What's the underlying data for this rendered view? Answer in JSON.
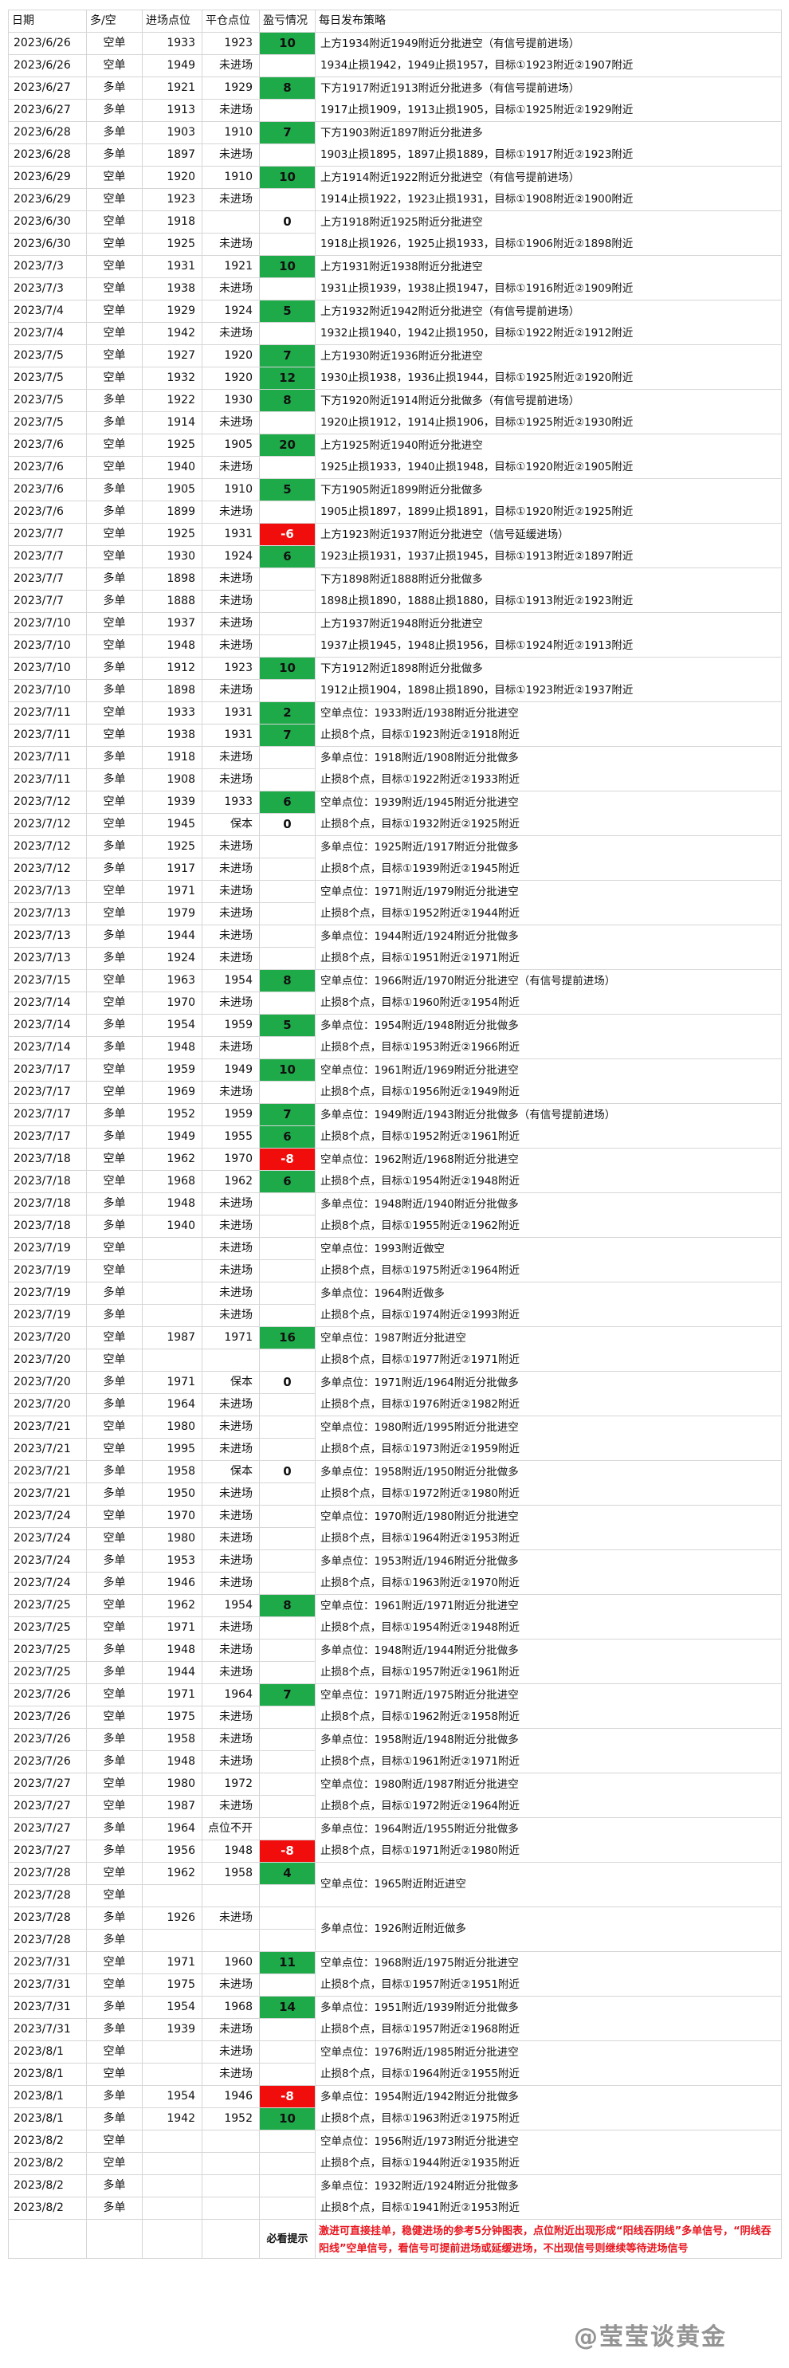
{
  "headers": [
    "日期",
    "多/空",
    "进场点位",
    "平仓点位",
    "盈亏情况",
    "每日发布策略"
  ],
  "rows": [
    {
      "d": "2023/6/26",
      "s": "空单",
      "e": "1933",
      "c": "1923",
      "p": "10"
    },
    {
      "d": "2023/6/26",
      "s": "空单",
      "e": "1949",
      "c": "未进场",
      "p": ""
    },
    {
      "d": "2023/6/27",
      "s": "多单",
      "e": "1921",
      "c": "1929",
      "p": "8"
    },
    {
      "d": "2023/6/27",
      "s": "多单",
      "e": "1913",
      "c": "未进场",
      "p": ""
    },
    {
      "d": "2023/6/28",
      "s": "多单",
      "e": "1903",
      "c": "1910",
      "p": "7"
    },
    {
      "d": "2023/6/28",
      "s": "多单",
      "e": "1897",
      "c": "未进场",
      "p": ""
    },
    {
      "d": "2023/6/29",
      "s": "空单",
      "e": "1920",
      "c": "1910",
      "p": "10"
    },
    {
      "d": "2023/6/29",
      "s": "空单",
      "e": "1923",
      "c": "未进场",
      "p": ""
    },
    {
      "d": "2023/6/30",
      "s": "空单",
      "e": "1918",
      "c": "",
      "p": "0"
    },
    {
      "d": "2023/6/30",
      "s": "空单",
      "e": "1925",
      "c": "未进场",
      "p": ""
    },
    {
      "d": "2023/7/3",
      "s": "空单",
      "e": "1931",
      "c": "1921",
      "p": "10"
    },
    {
      "d": "2023/7/3",
      "s": "空单",
      "e": "1938",
      "c": "未进场",
      "p": ""
    },
    {
      "d": "2023/7/4",
      "s": "空单",
      "e": "1929",
      "c": "1924",
      "p": "5"
    },
    {
      "d": "2023/7/4",
      "s": "空单",
      "e": "1942",
      "c": "未进场",
      "p": ""
    },
    {
      "d": "2023/7/5",
      "s": "空单",
      "e": "1927",
      "c": "1920",
      "p": "7"
    },
    {
      "d": "2023/7/5",
      "s": "空单",
      "e": "1932",
      "c": "1920",
      "p": "12"
    },
    {
      "d": "2023/7/5",
      "s": "多单",
      "e": "1922",
      "c": "1930",
      "p": "8"
    },
    {
      "d": "2023/7/5",
      "s": "多单",
      "e": "1914",
      "c": "未进场",
      "p": ""
    },
    {
      "d": "2023/7/6",
      "s": "空单",
      "e": "1925",
      "c": "1905",
      "p": "20"
    },
    {
      "d": "2023/7/6",
      "s": "空单",
      "e": "1940",
      "c": "未进场",
      "p": ""
    },
    {
      "d": "2023/7/6",
      "s": "多单",
      "e": "1905",
      "c": "1910",
      "p": "5"
    },
    {
      "d": "2023/7/6",
      "s": "多单",
      "e": "1899",
      "c": "未进场",
      "p": ""
    },
    {
      "d": "2023/7/7",
      "s": "空单",
      "e": "1925",
      "c": "1931",
      "p": "-6"
    },
    {
      "d": "2023/7/7",
      "s": "空单",
      "e": "1930",
      "c": "1924",
      "p": "6"
    },
    {
      "d": "2023/7/7",
      "s": "多单",
      "e": "1898",
      "c": "未进场",
      "p": ""
    },
    {
      "d": "2023/7/7",
      "s": "多单",
      "e": "1888",
      "c": "未进场",
      "p": ""
    },
    {
      "d": "2023/7/10",
      "s": "空单",
      "e": "1937",
      "c": "未进场",
      "p": ""
    },
    {
      "d": "2023/7/10",
      "s": "空单",
      "e": "1948",
      "c": "未进场",
      "p": ""
    },
    {
      "d": "2023/7/10",
      "s": "多单",
      "e": "1912",
      "c": "1923",
      "p": "10"
    },
    {
      "d": "2023/7/10",
      "s": "多单",
      "e": "1898",
      "c": "未进场",
      "p": ""
    },
    {
      "d": "2023/7/11",
      "s": "空单",
      "e": "1933",
      "c": "1931",
      "p": "2"
    },
    {
      "d": "2023/7/11",
      "s": "空单",
      "e": "1938",
      "c": "1931",
      "p": "7"
    },
    {
      "d": "2023/7/11",
      "s": "多单",
      "e": "1918",
      "c": "未进场",
      "p": ""
    },
    {
      "d": "2023/7/11",
      "s": "多单",
      "e": "1908",
      "c": "未进场",
      "p": ""
    },
    {
      "d": "2023/7/12",
      "s": "空单",
      "e": "1939",
      "c": "1933",
      "p": "6"
    },
    {
      "d": "2023/7/12",
      "s": "空单",
      "e": "1945",
      "c": "保本",
      "p": "0"
    },
    {
      "d": "2023/7/12",
      "s": "多单",
      "e": "1925",
      "c": "未进场",
      "p": ""
    },
    {
      "d": "2023/7/12",
      "s": "多单",
      "e": "1917",
      "c": "未进场",
      "p": ""
    },
    {
      "d": "2023/7/13",
      "s": "空单",
      "e": "1971",
      "c": "未进场",
      "p": ""
    },
    {
      "d": "2023/7/13",
      "s": "空单",
      "e": "1979",
      "c": "未进场",
      "p": ""
    },
    {
      "d": "2023/7/13",
      "s": "多单",
      "e": "1944",
      "c": "未进场",
      "p": ""
    },
    {
      "d": "2023/7/13",
      "s": "多单",
      "e": "1924",
      "c": "未进场",
      "p": ""
    },
    {
      "d": "2023/7/15",
      "s": "空单",
      "e": "1963",
      "c": "1954",
      "p": "8"
    },
    {
      "d": "2023/7/14",
      "s": "空单",
      "e": "1970",
      "c": "未进场",
      "p": ""
    },
    {
      "d": "2023/7/14",
      "s": "多单",
      "e": "1954",
      "c": "1959",
      "p": "5"
    },
    {
      "d": "2023/7/14",
      "s": "多单",
      "e": "1948",
      "c": "未进场",
      "p": ""
    },
    {
      "d": "2023/7/17",
      "s": "空单",
      "e": "1959",
      "c": "1949",
      "p": "10"
    },
    {
      "d": "2023/7/17",
      "s": "空单",
      "e": "1969",
      "c": "未进场",
      "p": ""
    },
    {
      "d": "2023/7/17",
      "s": "多单",
      "e": "1952",
      "c": "1959",
      "p": "7"
    },
    {
      "d": "2023/7/17",
      "s": "多单",
      "e": "1949",
      "c": "1955",
      "p": "6"
    },
    {
      "d": "2023/7/18",
      "s": "空单",
      "e": "1962",
      "c": "1970",
      "p": "-8"
    },
    {
      "d": "2023/7/18",
      "s": "空单",
      "e": "1968",
      "c": "1962",
      "p": "6"
    },
    {
      "d": "2023/7/18",
      "s": "多单",
      "e": "1948",
      "c": "未进场",
      "p": ""
    },
    {
      "d": "2023/7/18",
      "s": "多单",
      "e": "1940",
      "c": "未进场",
      "p": ""
    },
    {
      "d": "2023/7/19",
      "s": "空单",
      "e": "",
      "c": "未进场",
      "p": ""
    },
    {
      "d": "2023/7/19",
      "s": "空单",
      "e": "",
      "c": "未进场",
      "p": ""
    },
    {
      "d": "2023/7/19",
      "s": "多单",
      "e": "",
      "c": "未进场",
      "p": ""
    },
    {
      "d": "2023/7/19",
      "s": "多单",
      "e": "",
      "c": "未进场",
      "p": ""
    },
    {
      "d": "2023/7/20",
      "s": "空单",
      "e": "1987",
      "c": "1971",
      "p": "16"
    },
    {
      "d": "2023/7/20",
      "s": "空单",
      "e": "",
      "c": "",
      "p": ""
    },
    {
      "d": "2023/7/20",
      "s": "多单",
      "e": "1971",
      "c": "保本",
      "p": "0"
    },
    {
      "d": "2023/7/20",
      "s": "多单",
      "e": "1964",
      "c": "未进场",
      "p": ""
    },
    {
      "d": "2023/7/21",
      "s": "空单",
      "e": "1980",
      "c": "未进场",
      "p": ""
    },
    {
      "d": "2023/7/21",
      "s": "空单",
      "e": "1995",
      "c": "未进场",
      "p": ""
    },
    {
      "d": "2023/7/21",
      "s": "多单",
      "e": "1958",
      "c": "保本",
      "p": "0"
    },
    {
      "d": "2023/7/21",
      "s": "多单",
      "e": "1950",
      "c": "未进场",
      "p": ""
    },
    {
      "d": "2023/7/24",
      "s": "空单",
      "e": "1970",
      "c": "未进场",
      "p": ""
    },
    {
      "d": "2023/7/24",
      "s": "空单",
      "e": "1980",
      "c": "未进场",
      "p": ""
    },
    {
      "d": "2023/7/24",
      "s": "多单",
      "e": "1953",
      "c": "未进场",
      "p": ""
    },
    {
      "d": "2023/7/24",
      "s": "多单",
      "e": "1946",
      "c": "未进场",
      "p": ""
    },
    {
      "d": "2023/7/25",
      "s": "空单",
      "e": "1962",
      "c": "1954",
      "p": "8"
    },
    {
      "d": "2023/7/25",
      "s": "空单",
      "e": "1971",
      "c": "未进场",
      "p": ""
    },
    {
      "d": "2023/7/25",
      "s": "多单",
      "e": "1948",
      "c": "未进场",
      "p": ""
    },
    {
      "d": "2023/7/25",
      "s": "多单",
      "e": "1944",
      "c": "未进场",
      "p": ""
    },
    {
      "d": "2023/7/26",
      "s": "空单",
      "e": "1971",
      "c": "1964",
      "p": "7"
    },
    {
      "d": "2023/7/26",
      "s": "空单",
      "e": "1975",
      "c": "未进场",
      "p": ""
    },
    {
      "d": "2023/7/26",
      "s": "多单",
      "e": "1958",
      "c": "未进场",
      "p": ""
    },
    {
      "d": "2023/7/26",
      "s": "多单",
      "e": "1948",
      "c": "未进场",
      "p": ""
    },
    {
      "d": "2023/7/27",
      "s": "空单",
      "e": "1980",
      "c": "1972",
      "p": ""
    },
    {
      "d": "2023/7/27",
      "s": "空单",
      "e": "1987",
      "c": "未进场",
      "p": ""
    },
    {
      "d": "2023/7/27",
      "s": "多单",
      "e": "1964",
      "c": "点位不开",
      "p": ""
    },
    {
      "d": "2023/7/27",
      "s": "多单",
      "e": "1956",
      "c": "1948",
      "p": "-8"
    },
    {
      "d": "2023/7/28",
      "s": "空单",
      "e": "1962",
      "c": "1958",
      "p": "4"
    },
    {
      "d": "2023/7/28",
      "s": "空单",
      "e": "",
      "c": "",
      "p": ""
    },
    {
      "d": "2023/7/28",
      "s": "多单",
      "e": "1926",
      "c": "未进场",
      "p": ""
    },
    {
      "d": "2023/7/28",
      "s": "多单",
      "e": "",
      "c": "",
      "p": ""
    },
    {
      "d": "2023/7/31",
      "s": "空单",
      "e": "1971",
      "c": "1960",
      "p": "11"
    },
    {
      "d": "2023/7/31",
      "s": "空单",
      "e": "1975",
      "c": "未进场",
      "p": ""
    },
    {
      "d": "2023/7/31",
      "s": "多单",
      "e": "1954",
      "c": "1968",
      "p": "14"
    },
    {
      "d": "2023/7/31",
      "s": "多单",
      "e": "1939",
      "c": "未进场",
      "p": ""
    },
    {
      "d": "2023/8/1",
      "s": "空单",
      "e": "",
      "c": "未进场",
      "p": ""
    },
    {
      "d": "2023/8/1",
      "s": "空单",
      "e": "",
      "c": "未进场",
      "p": ""
    },
    {
      "d": "2023/8/1",
      "s": "多单",
      "e": "1954",
      "c": "1946",
      "p": "-8"
    },
    {
      "d": "2023/8/1",
      "s": "多单",
      "e": "1942",
      "c": "1952",
      "p": "10"
    },
    {
      "d": "2023/8/2",
      "s": "空单",
      "e": "",
      "c": "",
      "p": ""
    },
    {
      "d": "2023/8/2",
      "s": "空单",
      "e": "",
      "c": "",
      "p": ""
    },
    {
      "d": "2023/8/2",
      "s": "多单",
      "e": "",
      "c": "",
      "p": ""
    },
    {
      "d": "2023/8/2",
      "s": "多单",
      "e": "",
      "c": "",
      "p": ""
    }
  ],
  "strategies": [
    {
      "r": 0,
      "span": 2,
      "lines": [
        "上方1934附近1949附近分批进空（有信号提前进场）",
        "1934止损1942，1949止损1957，目标①1923附近②1907附近"
      ]
    },
    {
      "r": 2,
      "span": 2,
      "lines": [
        "下方1917附近1913附近分批进多（有信号提前进场）",
        "1917止损1909，1913止损1905，目标①1925附近②1929附近"
      ]
    },
    {
      "r": 4,
      "span": 2,
      "lines": [
        "下方1903附近1897附近分批进多",
        "1903止损1895，1897止损1889，目标①1917附近②1923附近"
      ]
    },
    {
      "r": 6,
      "span": 2,
      "lines": [
        "上方1914附近1922附近分批进空（有信号提前进场）",
        "1914止损1922，1923止损1931，目标①1908附近②1900附近"
      ]
    },
    {
      "r": 8,
      "span": 2,
      "lines": [
        "上方1918附近1925附近分批进空",
        "1918止损1926，1925止损1933，目标①1906附近②1898附近"
      ]
    },
    {
      "r": 10,
      "span": 2,
      "lines": [
        "上方1931附近1938附近分批进空",
        "1931止损1939，1938止损1947，目标①1916附近②1909附近"
      ]
    },
    {
      "r": 12,
      "span": 2,
      "lines": [
        "上方1932附近1942附近分批进空（有信号提前进场）",
        "1932止损1940，1942止损1950，目标①1922附近②1912附近"
      ]
    },
    {
      "r": 14,
      "span": 2,
      "lines": [
        "上方1930附近1936附近分批进空",
        "1930止损1938，1936止损1944，目标①1925附近②1920附近"
      ]
    },
    {
      "r": 16,
      "span": 2,
      "lines": [
        "下方1920附近1914附近分批做多（有信号提前进场）",
        "1920止损1912，1914止损1906，目标①1925附近②1930附近"
      ]
    },
    {
      "r": 18,
      "span": 2,
      "lines": [
        "上方1925附近1940附近分批进空",
        "1925止损1933，1940止损1948，目标①1920附近②1905附近"
      ]
    },
    {
      "r": 20,
      "span": 2,
      "lines": [
        "下方1905附近1899附近分批做多",
        "1905止损1897，1899止损1891，目标①1920附近②1925附近"
      ]
    },
    {
      "r": 22,
      "span": 2,
      "lines": [
        "上方1923附近1937附近分批进空（信号延缓进场）",
        "1923止损1931，1937止损1945，目标①1913附近②1897附近"
      ]
    },
    {
      "r": 24,
      "span": 2,
      "lines": [
        "下方1898附近1888附近分批做多",
        "1898止损1890，1888止损1880，目标①1913附近②1923附近"
      ]
    },
    {
      "r": 26,
      "span": 2,
      "lines": [
        "上方1937附近1948附近分批进空",
        "1937止损1945，1948止损1956，目标①1924附近②1913附近"
      ]
    },
    {
      "r": 28,
      "span": 2,
      "lines": [
        "下方1912附近1898附近分批做多",
        "1912止损1904，1898止损1890，目标①1923附近②1937附近"
      ]
    },
    {
      "r": 30,
      "span": 2,
      "lines": [
        "空单点位：1933附近/1938附近分批进空",
        "止损8个点，目标①1923附近②1918附近"
      ]
    },
    {
      "r": 32,
      "span": 2,
      "lines": [
        "多单点位：1918附近/1908附近分批做多",
        "止损8个点，目标①1922附近②1933附近"
      ]
    },
    {
      "r": 34,
      "span": 2,
      "lines": [
        "空单点位：1939附近/1945附近分批进空",
        "止损8个点，目标①1932附近②1925附近"
      ]
    },
    {
      "r": 36,
      "span": 2,
      "lines": [
        "多单点位：1925附近/1917附近分批做多",
        "止损8个点，目标①1939附近②1945附近"
      ]
    },
    {
      "r": 38,
      "span": 2,
      "lines": [
        "空单点位：1971附近/1979附近分批进空",
        "止损8个点，目标①1952附近②1944附近"
      ]
    },
    {
      "r": 40,
      "span": 2,
      "lines": [
        "多单点位：1944附近/1924附近分批做多",
        "止损8个点，目标①1951附近②1971附近"
      ]
    },
    {
      "r": 42,
      "span": 2,
      "lines": [
        "空单点位：1966附近/1970附近分批进空（有信号提前进场）",
        "止损8个点，目标①1960附近②1954附近"
      ]
    },
    {
      "r": 44,
      "span": 2,
      "lines": [
        "多单点位：1954附近/1948附近分批做多",
        "止损8个点，目标①1953附近②1966附近"
      ]
    },
    {
      "r": 46,
      "span": 2,
      "lines": [
        "空单点位：1961附近/1969附近分批进空",
        "止损8个点，目标①1956附近②1949附近"
      ]
    },
    {
      "r": 48,
      "span": 2,
      "lines": [
        "多单点位：1949附近/1943附近分批做多（有信号提前进场）",
        "止损8个点，目标①1952附近②1961附近"
      ]
    },
    {
      "r": 50,
      "span": 2,
      "lines": [
        "空单点位：1962附近/1968附近分批进空",
        "止损8个点，目标①1954附近②1948附近"
      ]
    },
    {
      "r": 52,
      "span": 2,
      "lines": [
        "多单点位：1948附近/1940附近分批做多",
        "止损8个点，目标①1955附近②1962附近"
      ]
    },
    {
      "r": 54,
      "span": 2,
      "lines": [
        "空单点位：1993附近做空",
        "止损8个点，目标①1975附近②1964附近"
      ]
    },
    {
      "r": 56,
      "span": 2,
      "lines": [
        "多单点位：1964附近做多",
        "止损8个点，目标①1974附近②1993附近"
      ]
    },
    {
      "r": 58,
      "span": 2,
      "lines": [
        "空单点位：1987附近分批进空",
        "止损8个点，目标①1977附近②1971附近"
      ]
    },
    {
      "r": 60,
      "span": 2,
      "lines": [
        "多单点位：1971附近/1964附近分批做多",
        "止损8个点，目标①1976附近②1982附近"
      ]
    },
    {
      "r": 62,
      "span": 2,
      "lines": [
        "空单点位：1980附近/1995附近分批进空",
        "止损8个点，目标①1973附近②1959附近"
      ]
    },
    {
      "r": 64,
      "span": 2,
      "lines": [
        "多单点位：1958附近/1950附近分批做多",
        "止损8个点，目标①1972附近②1980附近"
      ]
    },
    {
      "r": 66,
      "span": 2,
      "lines": [
        "空单点位：1970附近/1980附近分批进空",
        "止损8个点，目标①1964附近②1953附近"
      ]
    },
    {
      "r": 68,
      "span": 2,
      "lines": [
        "多单点位：1953附近/1946附近分批做多",
        "止损8个点，目标①1963附近②1970附近"
      ]
    },
    {
      "r": 70,
      "span": 2,
      "lines": [
        "空单点位：1961附近/1971附近分批进空",
        "止损8个点，目标①1954附近②1948附近"
      ]
    },
    {
      "r": 72,
      "span": 2,
      "lines": [
        "多单点位：1948附近/1944附近分批做多",
        "止损8个点，目标①1957附近②1961附近"
      ]
    },
    {
      "r": 74,
      "span": 2,
      "lines": [
        "空单点位：1971附近/1975附近分批进空",
        "止损8个点，目标①1962附近②1958附近"
      ]
    },
    {
      "r": 76,
      "span": 2,
      "lines": [
        "多单点位：1958附近/1948附近分批做多",
        "止损8个点，目标①1961附近②1971附近"
      ]
    },
    {
      "r": 78,
      "span": 2,
      "lines": [
        "空单点位：1980附近/1987附近分批进空",
        "止损8个点，目标①1972附近②1964附近"
      ]
    },
    {
      "r": 80,
      "span": 2,
      "lines": [
        "多单点位：1964附近/1955附近分批做多",
        "止损8个点，目标①1971附近②1980附近"
      ]
    },
    {
      "r": 82,
      "span": 2,
      "lines": [
        "空单点位：1965附近附近进空"
      ]
    },
    {
      "r": 84,
      "span": 2,
      "lines": [
        "多单点位：1926附近附近做多"
      ]
    },
    {
      "r": 86,
      "span": 2,
      "lines": [
        "空单点位：1968附近/1975附近分批进空",
        "止损8个点，目标①1957附近②1951附近"
      ]
    },
    {
      "r": 88,
      "span": 2,
      "lines": [
        "多单点位：1951附近/1939附近分批做多",
        "止损8个点，目标①1957附近②1968附近"
      ]
    },
    {
      "r": 90,
      "span": 2,
      "lines": [
        "空单点位：1976附近/1985附近分批进空",
        "止损8个点，目标①1964附近②1955附近"
      ]
    },
    {
      "r": 92,
      "span": 2,
      "lines": [
        "多单点位：1954附近/1942附近分批做多",
        "止损8个点，目标①1963附近②1975附近"
      ]
    },
    {
      "r": 94,
      "span": 2,
      "lines": [
        "空单点位：1956附近/1973附近分批进空",
        "止损8个点，目标①1944附近②1935附近"
      ]
    },
    {
      "r": 96,
      "span": 2,
      "lines": [
        "多单点位：1932附近/1924附近分批做多",
        "止损8个点，目标①1941附近②1953附近"
      ]
    }
  ],
  "notice": {
    "label": "必看提示",
    "text": "激进可直接挂单，稳健进场的参考5分钟图表，点位附近出现形成“阳线吞阴线”多单信号，“阴线吞阳线”空单信号，看信号可提前进场或延缓进场，不出现信号则继续等待进场信号"
  },
  "watermark": "@莹莹谈黄金",
  "colors": {
    "profit": "#1faa4a",
    "loss": "#f20d0d",
    "notice": "#e8161f"
  }
}
